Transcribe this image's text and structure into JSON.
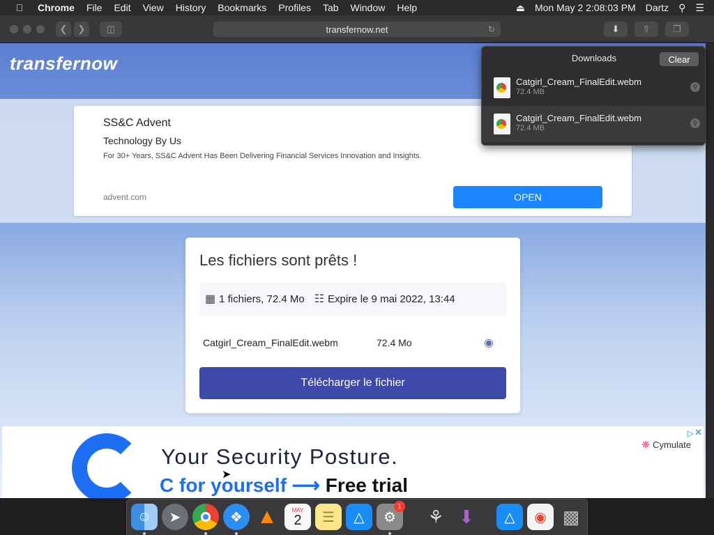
{
  "menubar": {
    "app_name": "Chrome",
    "items": [
      "File",
      "Edit",
      "View",
      "History",
      "Bookmarks",
      "Profiles",
      "Tab",
      "Window",
      "Help"
    ],
    "datetime": "Mon May 2  2:08:03 PM",
    "user": "Dartz"
  },
  "browser": {
    "url": "transfernow.net"
  },
  "site": {
    "logo": "transfernow"
  },
  "ad_top": {
    "advertiser": "SS&C Advent",
    "headline": "Technology By Us",
    "description": "For 30+ Years, SS&C Advent Has Been Delivering Financial Services Innovation and Insights.",
    "domain": "advent.com",
    "cta": "OPEN"
  },
  "transfer": {
    "title": "Les fichiers sont prêts !",
    "file_count": "1 fichiers, 72.4 Mo",
    "expiry": "Expire le 9 mai 2022, 13:44",
    "file_name": "Catgirl_Cream_FinalEdit.webm",
    "file_size": "72.4 Mo",
    "download_label": "Télécharger le fichier"
  },
  "ad_bottom": {
    "line1": "Your Security Posture.",
    "line2_prefix": "C for yourself ⟶",
    "line2_suffix": "Free trial",
    "brand": "Cymulate",
    "adchoice": "▷",
    "close": "✕"
  },
  "downloads": {
    "title": "Downloads",
    "clear": "Clear",
    "items": [
      {
        "name": "Catgirl_Cream_FinalEdit.webm",
        "size": "72.4 MB"
      },
      {
        "name": "Catgirl_Cream_FinalEdit.webm",
        "size": "72.4 MB"
      }
    ]
  },
  "dock": {
    "calendar_month": "MAY",
    "calendar_day": "2",
    "badge_count": "1"
  }
}
